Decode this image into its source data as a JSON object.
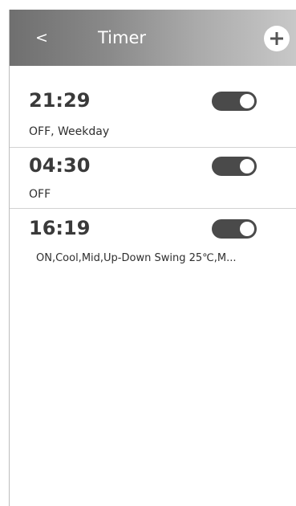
{
  "header": {
    "back_label": "<",
    "title": "Timer",
    "add_icon": "plus-icon"
  },
  "timers": [
    {
      "time": "21:29",
      "description": "OFF, Weekday",
      "enabled": true
    },
    {
      "time": "04:30",
      "description": "OFF",
      "enabled": true
    },
    {
      "time": "16:19",
      "description": "ON,Cool,Mid,Up-Down Swing 25℃,M...",
      "enabled": true
    }
  ],
  "colors": {
    "header_gradient_start": "#6f6f6f",
    "header_gradient_end": "#c8c8c8",
    "toggle_on": "#4a4a4a",
    "divider": "#d2d2d2"
  }
}
